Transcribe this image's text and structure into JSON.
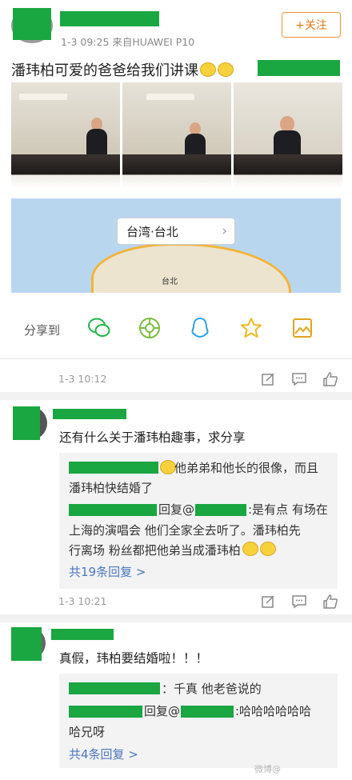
{
  "post": {
    "meta": "1-3 09:25 来自HUAWEI P10",
    "follow_label": "+关注",
    "text": "潘玮柏可爱的爸爸给我们讲课",
    "text_suffix": "(表情)"
  },
  "map": {
    "location": "台湾·台北",
    "city_label": "台北"
  },
  "share": {
    "label": "分享到",
    "icons": [
      "wechat-icon",
      "moments-icon",
      "qq-icon",
      "qzone-icon",
      "save-image-icon"
    ]
  },
  "post_actions": {
    "time": "1-3 10:12"
  },
  "comments": [
    {
      "text": "还有什么关于潘玮柏趣事，求分享",
      "replies": [
        "他弟弟和他长的很像，而且",
        "潘玮柏快结婚了",
        "回复@",
        ":是有点 有场在",
        "上海的演唱会 他们全家全去听了。潘玮柏先",
        "行离场 粉丝都把他弟当成潘玮柏"
      ],
      "more": "共19条回复 >",
      "time": "1-3 10:21"
    },
    {
      "text": "真假，玮柏要结婚啦！！！",
      "replies": [
        "：千真 他老爸说的",
        "回复@",
        ":哈哈哈哈哈哈",
        "哈兄呀"
      ],
      "more": "共4条回复 >"
    }
  ],
  "watermark": "微博@"
}
